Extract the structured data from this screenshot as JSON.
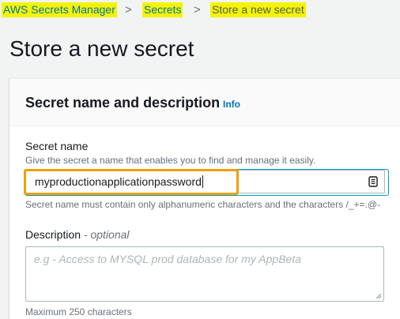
{
  "breadcrumb": {
    "items": [
      {
        "label": "AWS Secrets Manager"
      },
      {
        "label": "Secrets"
      },
      {
        "label": "Store a new secret"
      }
    ],
    "separator": ">"
  },
  "page": {
    "title": "Store a new secret"
  },
  "panel": {
    "title": "Secret name and description",
    "info_link": "Info"
  },
  "secret_name": {
    "label": "Secret name",
    "description": "Give the secret a name that enables you to find and manage it easily.",
    "value": "myproductionapplicationpassword",
    "constraint": "Secret name must contain only alphanumeric characters and the characters /_+=.@-",
    "icon": "keyboard-icon"
  },
  "description": {
    "label": "Description",
    "optional_label": "- optional",
    "placeholder": "e.g - Access to MYSQL prod database for my AppBeta",
    "value": "",
    "constraint": "Maximum 250 characters"
  },
  "colors": {
    "highlight": "#f4f400",
    "link": "#0073bb",
    "focus_ring": "#00a1c9",
    "annotation_box": "#f0a000"
  }
}
